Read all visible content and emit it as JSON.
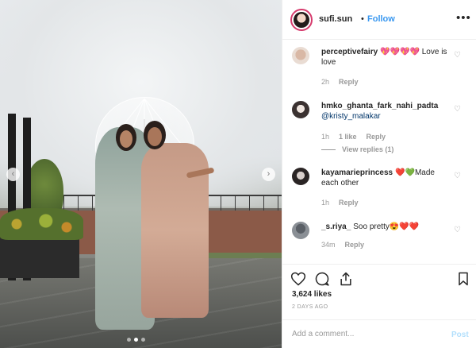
{
  "header": {
    "username": "sufi.sun",
    "separator": "•",
    "follow_label": "Follow",
    "more_label": "•••"
  },
  "comments": [
    {
      "username": "perceptivefairy",
      "text": "💖💖💖💖 Love is love",
      "time": "2h",
      "reply_label": "Reply",
      "avatar_colors": [
        "#e9dcd3",
        "#d9b8a5"
      ]
    },
    {
      "username": "hmko_ghanta_fark_nahi_padta",
      "mention": "@kristy_malakar",
      "text": "",
      "time": "1h",
      "likes": "1 like",
      "reply_label": "Reply",
      "view_replies": "View replies (1)",
      "avatar_colors": [
        "#3b3231",
        "#f0e6e0"
      ]
    },
    {
      "username": "kayamarieprincess",
      "text": "❤️💚Made each other",
      "time": "1h",
      "reply_label": "Reply",
      "avatar_colors": [
        "#2a2424",
        "#d8cfcb"
      ]
    },
    {
      "username": "_s.riya_",
      "text": "Soo pretty😍❤️❤️",
      "time": "34m",
      "reply_label": "Reply",
      "avatar_colors": [
        "#8a8f95",
        "#5a5f66"
      ]
    }
  ],
  "actions": {
    "heart_icon": "heart-icon",
    "comment_icon": "comment-icon",
    "share_icon": "share-icon",
    "bookmark_icon": "bookmark-icon"
  },
  "likes_text": "3,624 likes",
  "date_text": "2 DAYS AGO",
  "add_comment": {
    "placeholder": "Add a comment...",
    "post_label": "Post"
  },
  "carousel": {
    "dot_count": 3,
    "active_dot": 1
  },
  "colors": {
    "follow": "#3897f0",
    "post_disabled": "#b2dffc",
    "story_ring": "#d63b6d"
  }
}
